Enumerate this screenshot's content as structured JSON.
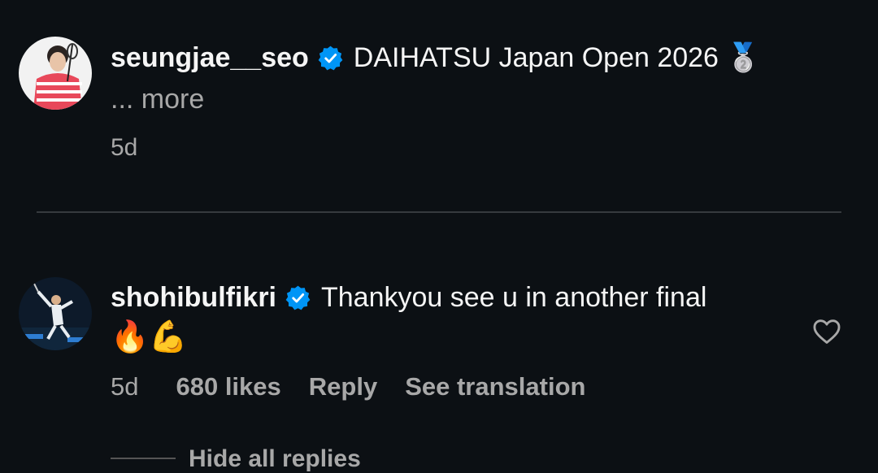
{
  "caption": {
    "username": "seungjae__seo",
    "text": "DAIHATSU Japan Open 2026 🥈",
    "more_label": "... more",
    "time": "5d"
  },
  "comment": {
    "username": "shohibulfikri",
    "text": "Thankyou see u in another final",
    "emojis": "🔥💪",
    "time": "5d",
    "likes": "680 likes",
    "reply_label": "Reply",
    "translation_label": "See translation",
    "hide_replies_label": "Hide all replies"
  },
  "colors": {
    "background": "#0c1014",
    "verified_blue": "#0095f6",
    "secondary_text": "#a8a8a8"
  },
  "icons": {
    "verified": "verified-badge-icon",
    "like": "heart-outline-icon"
  }
}
